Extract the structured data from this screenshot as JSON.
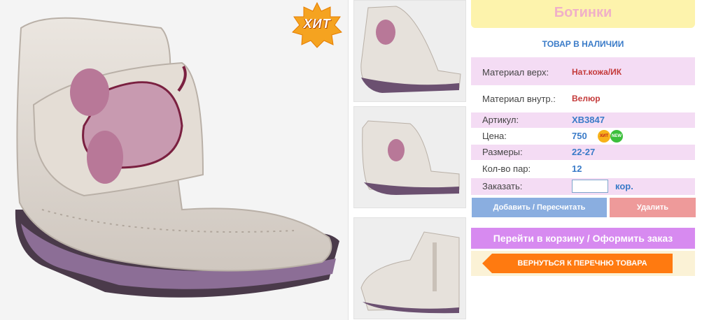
{
  "product": {
    "title": "Ботинки",
    "stock_status": "ТОВАР В НАЛИЧИИ",
    "hit_badge": "ХИТ"
  },
  "specs": [
    {
      "label": "Материал верх:",
      "value": "Нат.кожа/ИК"
    },
    {
      "label": "Материал внутр.:",
      "value": "Велюр"
    },
    {
      "label": "Артикул:",
      "value": "XB3847"
    },
    {
      "label": "Цена:",
      "value": "750"
    },
    {
      "label": "Размеры:",
      "value": "22-27"
    },
    {
      "label": "Кол-во пар:",
      "value": "12"
    }
  ],
  "price_badges": {
    "hit": "ХИТ",
    "new": "NEW"
  },
  "order": {
    "label": "Заказать:",
    "value": "",
    "unit": "кор."
  },
  "buttons": {
    "add": "Добавить / Пересчитать",
    "delete": "Удалить",
    "cart": "Перейти в корзину / Оформить заказ",
    "back": "ВЕРНУТЬСЯ К ПЕРЕЧНЮ ТОВАРА"
  },
  "colors": {
    "title_bg": "#fdf3ac",
    "title_text": "#f0b0c8",
    "accent_blue": "#3a7bc8",
    "row_pink": "#f4dcf4",
    "value_red": "#c43a3a",
    "add_button": "#8aaee0",
    "delete_button": "#ee9a9a",
    "cart_button": "#d78af0",
    "back_button": "#ff7a10"
  }
}
